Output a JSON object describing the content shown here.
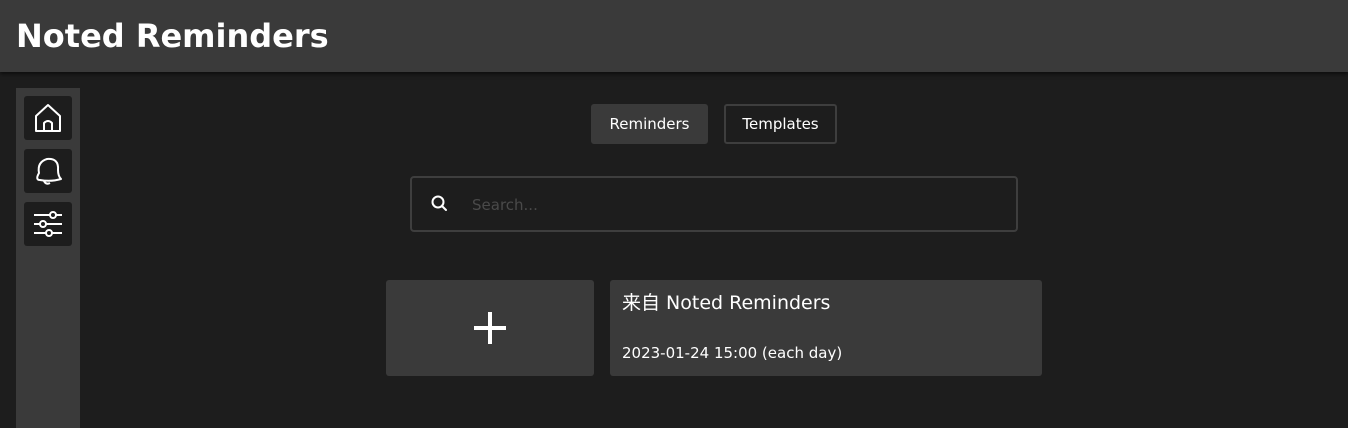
{
  "header": {
    "title": "Noted Reminders"
  },
  "sidebar": {
    "items": [
      {
        "icon": "home-icon"
      },
      {
        "icon": "bell-icon"
      },
      {
        "icon": "sliders-icon"
      }
    ]
  },
  "tabs": [
    {
      "label": "Reminders",
      "active": true
    },
    {
      "label": "Templates",
      "active": false
    }
  ],
  "search": {
    "placeholder": "Search...",
    "value": ""
  },
  "reminders": [
    {
      "title": "来自 Noted Reminders",
      "schedule": "2023-01-24 15:00 (each day)"
    }
  ],
  "colors": {
    "background": "#1d1d1d",
    "panel": "#3a3a3a",
    "border": "#3e3e3e",
    "text": "#ffffff"
  }
}
